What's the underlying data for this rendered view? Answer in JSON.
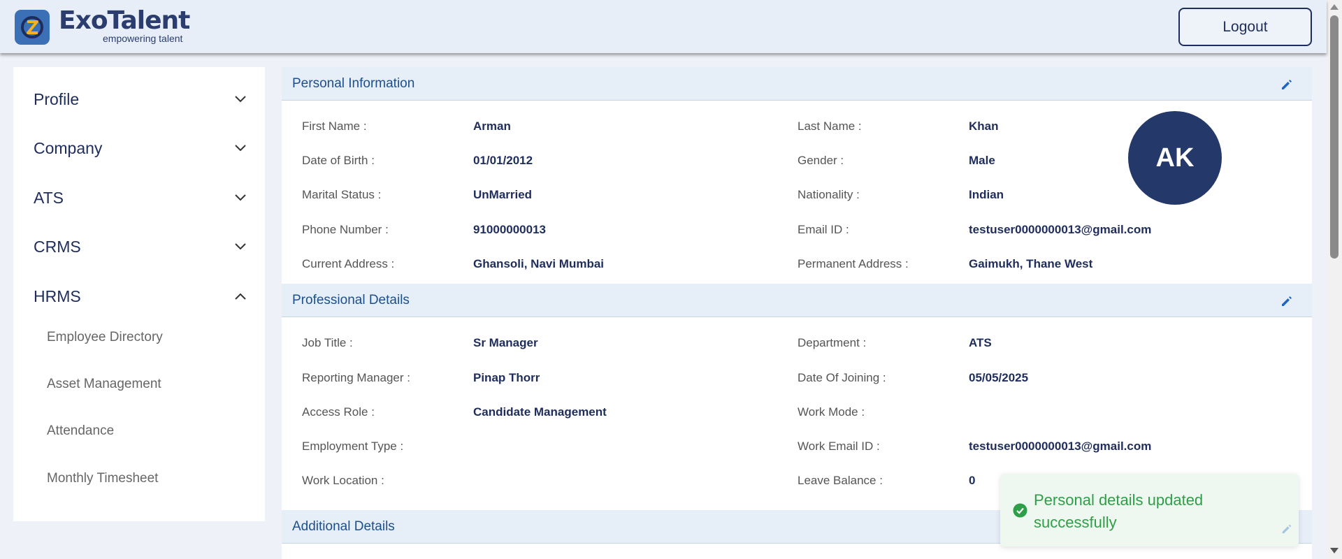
{
  "header": {
    "brand_name": "ExoTalent",
    "brand_tagline": "empowering talent",
    "logout_label": "Logout"
  },
  "sidebar": {
    "items": [
      {
        "label": "Profile",
        "expanded": false
      },
      {
        "label": "Company",
        "expanded": false
      },
      {
        "label": "ATS",
        "expanded": false
      },
      {
        "label": "CRMS",
        "expanded": false
      },
      {
        "label": "HRMS",
        "expanded": true
      }
    ],
    "hrms_subitems": [
      "Employee Directory",
      "Asset Management",
      "Attendance",
      "Monthly Timesheet"
    ]
  },
  "personal": {
    "title": "Personal Information",
    "fields": [
      {
        "label": "First Name :",
        "value": "Arman"
      },
      {
        "label": "Last Name :",
        "value": "Khan"
      },
      {
        "label": "Date of Birth :",
        "value": "01/01/2012"
      },
      {
        "label": "Gender :",
        "value": "Male"
      },
      {
        "label": "Marital Status :",
        "value": "UnMarried"
      },
      {
        "label": "Nationality :",
        "value": "Indian"
      },
      {
        "label": "Phone Number :",
        "value": "91000000013"
      },
      {
        "label": "Email ID :",
        "value": "testuser0000000013@gmail.com"
      },
      {
        "label": "Current Address :",
        "value": "Ghansoli, Navi Mumbai"
      },
      {
        "label": "Permanent Address :",
        "value": "Gaimukh, Thane West"
      }
    ],
    "avatar_initials": "AK"
  },
  "professional": {
    "title": "Professional Details",
    "fields": [
      {
        "label": "Job Title :",
        "value": "Sr Manager"
      },
      {
        "label": "Department :",
        "value": "ATS"
      },
      {
        "label": "Reporting Manager :",
        "value": "Pinap Thorr"
      },
      {
        "label": "Date Of Joining :",
        "value": "05/05/2025"
      },
      {
        "label": "Access Role :",
        "value": "Candidate Management"
      },
      {
        "label": "Work Mode :",
        "value": ""
      },
      {
        "label": "Employment Type :",
        "value": ""
      },
      {
        "label": "Work Email ID :",
        "value": "testuser0000000013@gmail.com"
      },
      {
        "label": "Work Location :",
        "value": ""
      },
      {
        "label": "Leave Balance :",
        "value": "0"
      }
    ]
  },
  "additional": {
    "title": "Additional Details"
  },
  "toast": {
    "message": "Personal details updated successfully",
    "status": "success"
  },
  "icons": {
    "edit": "pencil-icon",
    "chevron_down": "chevron-down-icon",
    "chevron_up": "chevron-up-icon",
    "success": "check-circle-icon"
  },
  "colors": {
    "navy": "#1f2d5c",
    "avatar_bg": "#243869",
    "section_title": "#1d4f8f",
    "edit_icon": "#1f66c4",
    "success_green": "#2e9e48"
  }
}
